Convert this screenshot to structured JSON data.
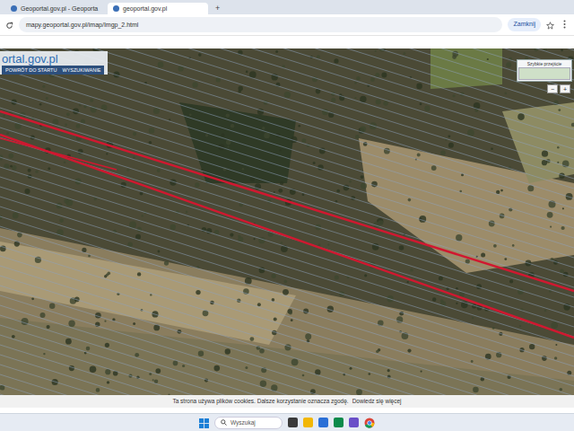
{
  "browser": {
    "tabs": [
      {
        "label": "Geoportal.gov.pl - Geoporta",
        "selected": false
      },
      {
        "label": "geoportal.gov.pl",
        "selected": true
      }
    ],
    "new_tab": "+",
    "address": "mapy.geoportal.gov.pl/imap/Imgp_2.html",
    "action": "Zamknij"
  },
  "map": {
    "logo": "ortal.gov.pl",
    "menu": [
      "POWRÓT DO STARTU",
      "WYSZUKIWANIE"
    ],
    "overview_label": "Szybkie przejście",
    "zoom": [
      "−",
      "+"
    ]
  },
  "cookie_bar": {
    "text": "Ta strona używa plików cookies. Dalsze korzystanie oznacza zgodę.",
    "link": "Dowiedz się więcej"
  },
  "taskbar": {
    "search_placeholder": "Wyszukaj"
  }
}
